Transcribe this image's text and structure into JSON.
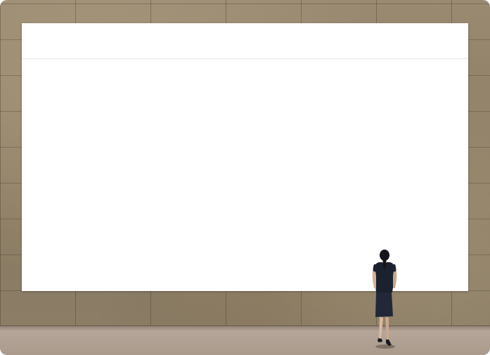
{
  "panel": {
    "title": ""
  },
  "scene": {
    "wall_color": "#8f7f67",
    "floor_color": "#b4a497",
    "panel_color": "#ffffff",
    "figure_icon": "standing-woman-figure"
  }
}
